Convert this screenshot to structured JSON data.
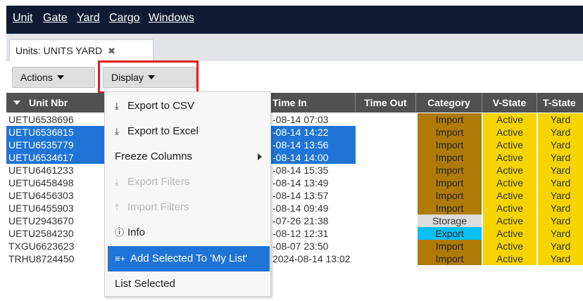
{
  "menubar": {
    "items": [
      {
        "label": "Unit"
      },
      {
        "label": "Gate"
      },
      {
        "label": "Yard"
      },
      {
        "label": "Cargo"
      },
      {
        "label": "Windows"
      }
    ]
  },
  "tab": {
    "label": "Units: UNITS YARD",
    "close": "✖"
  },
  "toolbar": {
    "actions_label": "Actions",
    "display_label": "Display"
  },
  "grid": {
    "headers": {
      "unit_nbr": "Unit Nbr",
      "time_in": "Time In",
      "time_out": "Time Out",
      "category": "Category",
      "v_state": "V-State",
      "t_state": "T-State"
    },
    "rows": [
      {
        "unit": "UETU6538696",
        "time_in": "-08-14 07:03",
        "category": "Import",
        "v_state": "Active",
        "t_state": "Yard"
      },
      {
        "unit": "UETU6536815",
        "time_in": "-08-14 14:22",
        "category": "Import",
        "v_state": "Active",
        "t_state": "Yard"
      },
      {
        "unit": "UETU6535779",
        "time_in": "-08-14 13:56",
        "category": "Import",
        "v_state": "Active",
        "t_state": "Yard"
      },
      {
        "unit": "UETU6534617",
        "time_in": "-08-14 14:00",
        "category": "Import",
        "v_state": "Active",
        "t_state": "Yard"
      },
      {
        "unit": "UETU6461233",
        "time_in": "-08-14 15:35",
        "category": "Import",
        "v_state": "Active",
        "t_state": "Yard"
      },
      {
        "unit": "UETU6458498",
        "time_in": "-08-14 13:49",
        "category": "Import",
        "v_state": "Active",
        "t_state": "Yard"
      },
      {
        "unit": "UETU6456303",
        "time_in": "-08-14 13:57",
        "category": "Import",
        "v_state": "Active",
        "t_state": "Yard"
      },
      {
        "unit": "UETU6455903",
        "time_in": "-08-14 09:49",
        "category": "Import",
        "v_state": "Active",
        "t_state": "Yard"
      },
      {
        "unit": "UETU2943670",
        "time_in": "-07-26 21:38",
        "category": "Storage",
        "v_state": "Active",
        "t_state": "Yard"
      },
      {
        "unit": "UETU2584230",
        "time_in": "-08-12 12:31",
        "category": "Export",
        "v_state": "Active",
        "t_state": "Yard"
      },
      {
        "unit": "TXGU6623623",
        "time_in": "-08-07 23:50",
        "category": "Import",
        "v_state": "Active",
        "t_state": "Yard"
      },
      {
        "unit": "TRHU8724450",
        "time_in": "2024-08-14 13:02",
        "category": "Import",
        "v_state": "Active",
        "t_state": "Yard"
      }
    ]
  },
  "display_menu": {
    "items": [
      {
        "label": "Export to CSV",
        "icon": "download-icon",
        "glyph": "⤓"
      },
      {
        "label": "Export to Excel",
        "icon": "download-icon",
        "glyph": "⤓"
      },
      {
        "label": "Freeze Columns"
      },
      {
        "label": "Export Filters",
        "icon": "download-icon",
        "glyph": "⤓"
      },
      {
        "label": "Import Filters",
        "icon": "upload-icon",
        "glyph": "⤒"
      },
      {
        "label": "Info",
        "icon": "info-icon",
        "glyph": "ⓘ"
      },
      {
        "label": "Add Selected To 'My List'",
        "icon": "list-add-icon",
        "glyph": "≡+"
      },
      {
        "label": "List Selected"
      }
    ]
  },
  "colors": {
    "menubar_bg": "#0f1b33",
    "selection_blue": "#1f74d6",
    "import_brown": "#b07a07",
    "export_cyan": "#05bff5",
    "storage_gray": "#dcdcdc",
    "state_yellow": "#f6d400",
    "highlight_red": "#e0201d"
  }
}
